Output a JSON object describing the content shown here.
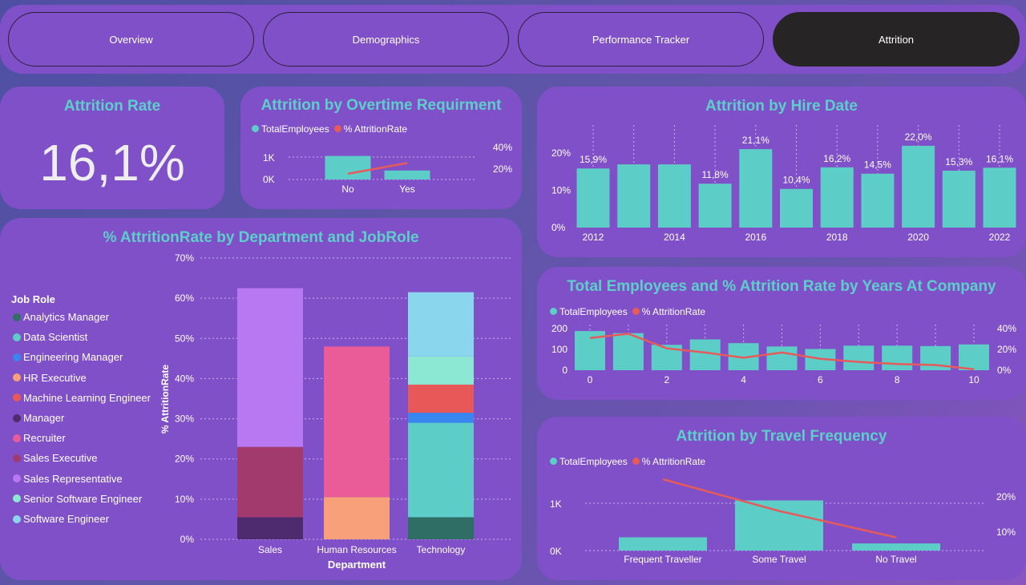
{
  "tabs": [
    {
      "label": "Overview",
      "active": false
    },
    {
      "label": "Demographics",
      "active": false
    },
    {
      "label": "Performance Tracker",
      "active": false
    },
    {
      "label": "Attrition",
      "active": true
    }
  ],
  "kpi": {
    "title": "Attrition Rate",
    "value": "16,1%"
  },
  "colors": {
    "bar": "#5dcdc7",
    "line": "#e65a5a",
    "title": "#5dcfca",
    "panel": "#8050c8"
  },
  "legend": {
    "total": "TotalEmployees",
    "rate": "% AttritionRate"
  },
  "chart_data": [
    {
      "id": "overtime",
      "type": "bar",
      "title": "Attrition by Overtime Requirment",
      "categories": [
        "No",
        "Yes"
      ],
      "series": [
        {
          "name": "TotalEmployees",
          "values": [
            1050,
            400
          ]
        },
        {
          "name": "% AttritionRate",
          "values": [
            10.5,
            30.5
          ]
        }
      ],
      "y_ticks": [
        "0K",
        "1K"
      ],
      "y2_ticks": [
        "20%",
        "40%"
      ]
    },
    {
      "id": "hire",
      "type": "bar",
      "title": "Attrition by Hire Date",
      "categories": [
        2012,
        2013,
        2014,
        2015,
        2016,
        2017,
        2018,
        2019,
        2020,
        2021,
        2022
      ],
      "values": [
        15.9,
        17.0,
        17.0,
        11.8,
        21.1,
        10.4,
        16.2,
        14.5,
        22.0,
        15.3,
        16.1
      ],
      "data_labels": [
        "15,9%",
        "",
        "",
        "11,8%",
        "21,1%",
        "10,4%",
        "16,2%",
        "14,5%",
        "22,0%",
        "15,3%",
        "16,1%"
      ],
      "x_ticks": [
        "2012",
        "2014",
        "2016",
        "2018",
        "2020",
        "2022"
      ],
      "y_ticks": [
        "0%",
        "10%",
        "20%"
      ],
      "ylim": [
        0,
        25
      ]
    },
    {
      "id": "dept",
      "type": "bar",
      "title": "% AttritionRate by Department and JobRole",
      "xlabel": "Department",
      "ylabel": "% AttritionRate",
      "legend_title": "Job Role",
      "categories": [
        "Sales",
        "Human Resources",
        "Technology"
      ],
      "y_ticks": [
        "0%",
        "10%",
        "20%",
        "30%",
        "40%",
        "50%",
        "60%",
        "70%"
      ],
      "ylim": [
        0,
        70
      ],
      "roles": [
        {
          "name": "Analytics Manager",
          "color": "#2e6e64"
        },
        {
          "name": "Data Scientist",
          "color": "#5dcdc7"
        },
        {
          "name": "Engineering Manager",
          "color": "#3a86f0"
        },
        {
          "name": "HR Executive",
          "color": "#f8a07a"
        },
        {
          "name": "Machine Learning Engineer",
          "color": "#e85858"
        },
        {
          "name": "Manager",
          "color": "#4e2a6e"
        },
        {
          "name": "Recruiter",
          "color": "#ea5c98"
        },
        {
          "name": "Sales Executive",
          "color": "#a23a6e"
        },
        {
          "name": "Sales Representative",
          "color": "#b878f2"
        },
        {
          "name": "Senior Software Engineer",
          "color": "#8ce8d2"
        },
        {
          "name": "Software Engineer",
          "color": "#8ad6ec"
        }
      ],
      "stacks": [
        {
          "category": "Sales",
          "segments": [
            {
              "role": "Manager",
              "value": 5.5
            },
            {
              "role": "Sales Executive",
              "value": 17.5
            },
            {
              "role": "Sales Representative",
              "value": 39.5
            }
          ]
        },
        {
          "category": "Human Resources",
          "segments": [
            {
              "role": "HR Executive",
              "value": 10.5
            },
            {
              "role": "Recruiter",
              "value": 37.5
            }
          ]
        },
        {
          "category": "Technology",
          "segments": [
            {
              "role": "Analytics Manager",
              "value": 5.5
            },
            {
              "role": "Data Scientist",
              "value": 23.5
            },
            {
              "role": "Engineering Manager",
              "value": 2.5
            },
            {
              "role": "Machine Learning Engineer",
              "value": 7.0
            },
            {
              "role": "Senior Software Engineer",
              "value": 7.0
            },
            {
              "role": "Software Engineer",
              "value": 16.0
            }
          ]
        }
      ]
    },
    {
      "id": "years",
      "type": "bar",
      "title": "Total Employees and % Attrition Rate by Years At Company",
      "categories": [
        0,
        1,
        2,
        3,
        4,
        5,
        6,
        7,
        8,
        9,
        10
      ],
      "series": [
        {
          "name": "TotalEmployees",
          "values": [
            188,
            178,
            122,
            148,
            130,
            114,
            102,
            118,
            118,
            116,
            124
          ]
        },
        {
          "name": "% AttritionRate",
          "values": [
            31,
            35,
            21,
            17,
            12,
            17,
            11,
            8,
            6,
            5,
            1
          ]
        }
      ],
      "x_ticks": [
        "0",
        "2",
        "4",
        "6",
        "8",
        "10"
      ],
      "y_ticks": [
        "0",
        "100",
        "200"
      ],
      "y2_ticks": [
        "0%",
        "20%",
        "40%"
      ]
    },
    {
      "id": "travel",
      "type": "bar",
      "title": "Attrition by Travel Frequency",
      "categories": [
        "Frequent Traveller",
        "Some Travel",
        "No Travel"
      ],
      "series": [
        {
          "name": "TotalEmployees",
          "values": [
            280,
            1060,
            150
          ]
        },
        {
          "name": "% AttritionRate",
          "values": [
            25,
            16,
            8.5
          ]
        }
      ],
      "y_ticks": [
        "0K",
        "1K"
      ],
      "y2_ticks": [
        "10%",
        "20%"
      ]
    }
  ]
}
